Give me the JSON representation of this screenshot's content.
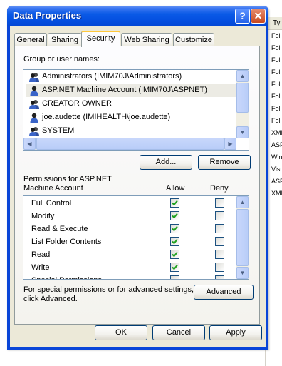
{
  "background_list": {
    "header": "Ty",
    "rows": [
      "Fol",
      "Fol",
      "Fol",
      "Fol",
      "Fol",
      "Fol",
      "Fol",
      "Fol",
      "XMI",
      "ASP",
      "Win",
      "Visu",
      "ASP",
      "XMI"
    ]
  },
  "window": {
    "title": "Data Properties",
    "help_glyph": "?",
    "close_glyph": "✕"
  },
  "tabs": [
    "General",
    "Sharing",
    "Security",
    "Web Sharing",
    "Customize"
  ],
  "active_tab": "Security",
  "groups": {
    "label": "Group or user names:",
    "items": [
      {
        "name": "Administrators (IMIM70J\\Administrators)",
        "icon": "group-icon"
      },
      {
        "name": "ASP.NET Machine Account (IMIM70J\\ASPNET)",
        "icon": "user-icon"
      },
      {
        "name": "CREATOR OWNER",
        "icon": "group-icon"
      },
      {
        "name": "joe.audette (IMIHEALTH\\joe.audette)",
        "icon": "user-icon"
      },
      {
        "name": "SYSTEM",
        "icon": "group-icon"
      }
    ],
    "selected_index": 1
  },
  "buttons": {
    "add": "Add...",
    "remove": "Remove",
    "advanced": "Advanced",
    "ok": "OK",
    "cancel": "Cancel",
    "apply": "Apply"
  },
  "permissions": {
    "label_line1": "Permissions for ASP.NET",
    "label_line2": "Machine Account",
    "allow_header": "Allow",
    "deny_header": "Deny",
    "rows": [
      {
        "name": "Full Control",
        "allow": true,
        "deny": false
      },
      {
        "name": "Modify",
        "allow": true,
        "deny": false
      },
      {
        "name": "Read & Execute",
        "allow": true,
        "deny": false
      },
      {
        "name": "List Folder Contents",
        "allow": true,
        "deny": false
      },
      {
        "name": "Read",
        "allow": true,
        "deny": false
      },
      {
        "name": "Write",
        "allow": true,
        "deny": false
      },
      {
        "name": "Special Permissions",
        "allow": false,
        "deny": false
      }
    ]
  },
  "advanced_note": {
    "line1": "For special permissions or for advanced settings,",
    "line2": "click Advanced."
  },
  "colors": {
    "title_bar": "#0550e1",
    "dialog_face": "#ece9d8",
    "checkmark": "#21a121",
    "active_tab_accent": "#ffc83c"
  }
}
